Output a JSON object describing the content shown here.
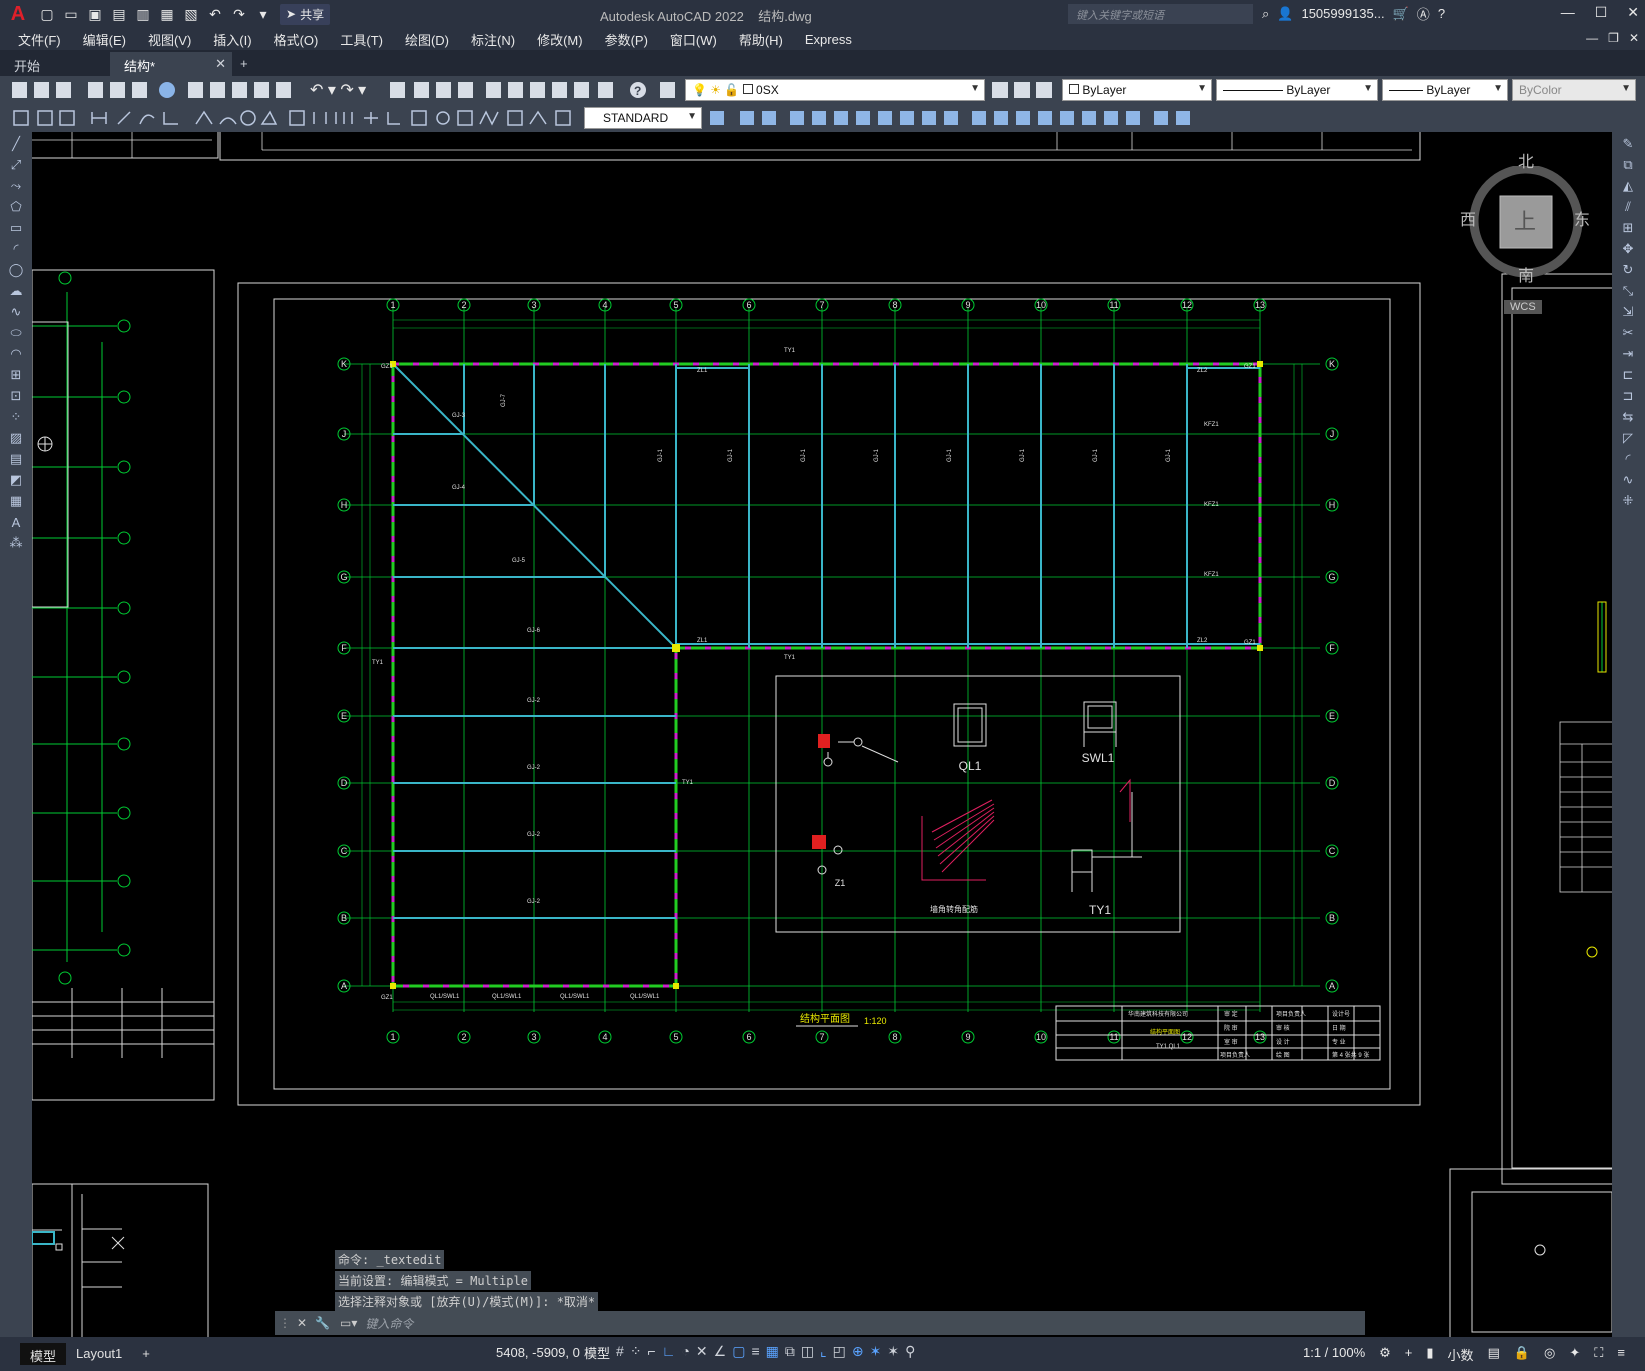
{
  "app": {
    "logo": "A",
    "title": "Autodesk AutoCAD 2022",
    "document": "结构.dwg",
    "share_label": "共享",
    "search_placeholder": "键入关键字或短语",
    "user": "1505999135..."
  },
  "menu": [
    "文件(F)",
    "编辑(E)",
    "视图(V)",
    "插入(I)",
    "格式(O)",
    "工具(T)",
    "绘图(D)",
    "标注(N)",
    "修改(M)",
    "参数(P)",
    "窗口(W)",
    "帮助(H)",
    "Express"
  ],
  "tabs": [
    {
      "label": "开始"
    },
    {
      "label": "结构*"
    }
  ],
  "toolbar": {
    "layer": "0SX",
    "color": "ByLayer",
    "linetype": "ByLayer",
    "lineweight": "ByLayer",
    "plotstyle": "ByColor",
    "textstyle": "STANDARD"
  },
  "viewcube": {
    "north": "北",
    "south": "南",
    "east": "东",
    "west": "西",
    "top": "上",
    "wcs": "WCS"
  },
  "drawing": {
    "plan_title": "结构平面图",
    "plan_scale": "1:120",
    "column_numbers": [
      "1",
      "2",
      "3",
      "4",
      "5",
      "6",
      "7",
      "8",
      "9",
      "10",
      "11",
      "12",
      "13"
    ],
    "row_letters": [
      "K",
      "J",
      "H",
      "G",
      "F",
      "E",
      "D",
      "C",
      "B",
      "A"
    ],
    "details": [
      "QL1",
      "SWL1",
      "Z1",
      "TY1",
      "墙角转角配筋"
    ],
    "titleblock": {
      "company": "华南建筑科技有限公司",
      "sheet_title": "结构平面图",
      "sheet_sub": "TY1 QL1",
      "sheet_no": "第 4 张共 9 张",
      "rows": [
        [
          "审 定",
          "项目负责人",
          "设计号"
        ],
        [
          "院 审",
          "审 核",
          "日 期"
        ],
        [
          "室 审",
          "设 计",
          "专 业"
        ],
        [
          "项目负责人",
          "绘 图",
          "第 4 张共 9 张"
        ]
      ]
    },
    "beam_labels": [
      "GJ-1",
      "GJ-2",
      "GJ-3",
      "GJ-4",
      "GJ-5",
      "GJ-6",
      "GJ-7",
      "GZ1",
      "KFZ1",
      "TY1",
      "ZL1",
      "ZL2",
      "QL1/SWL1"
    ]
  },
  "command": {
    "history": [
      "命令: _textedit",
      "当前设置: 编辑模式 = Multiple",
      "选择注释对象或 [放弃(U)/模式(M)]: *取消*"
    ],
    "placeholder": "键入命令"
  },
  "status": {
    "model_tab": "模型",
    "layout_tab": "Layout1",
    "coords": "5408, -5909, 0",
    "space": "模型",
    "scale": "1:1 / 100%",
    "units": "小数"
  }
}
